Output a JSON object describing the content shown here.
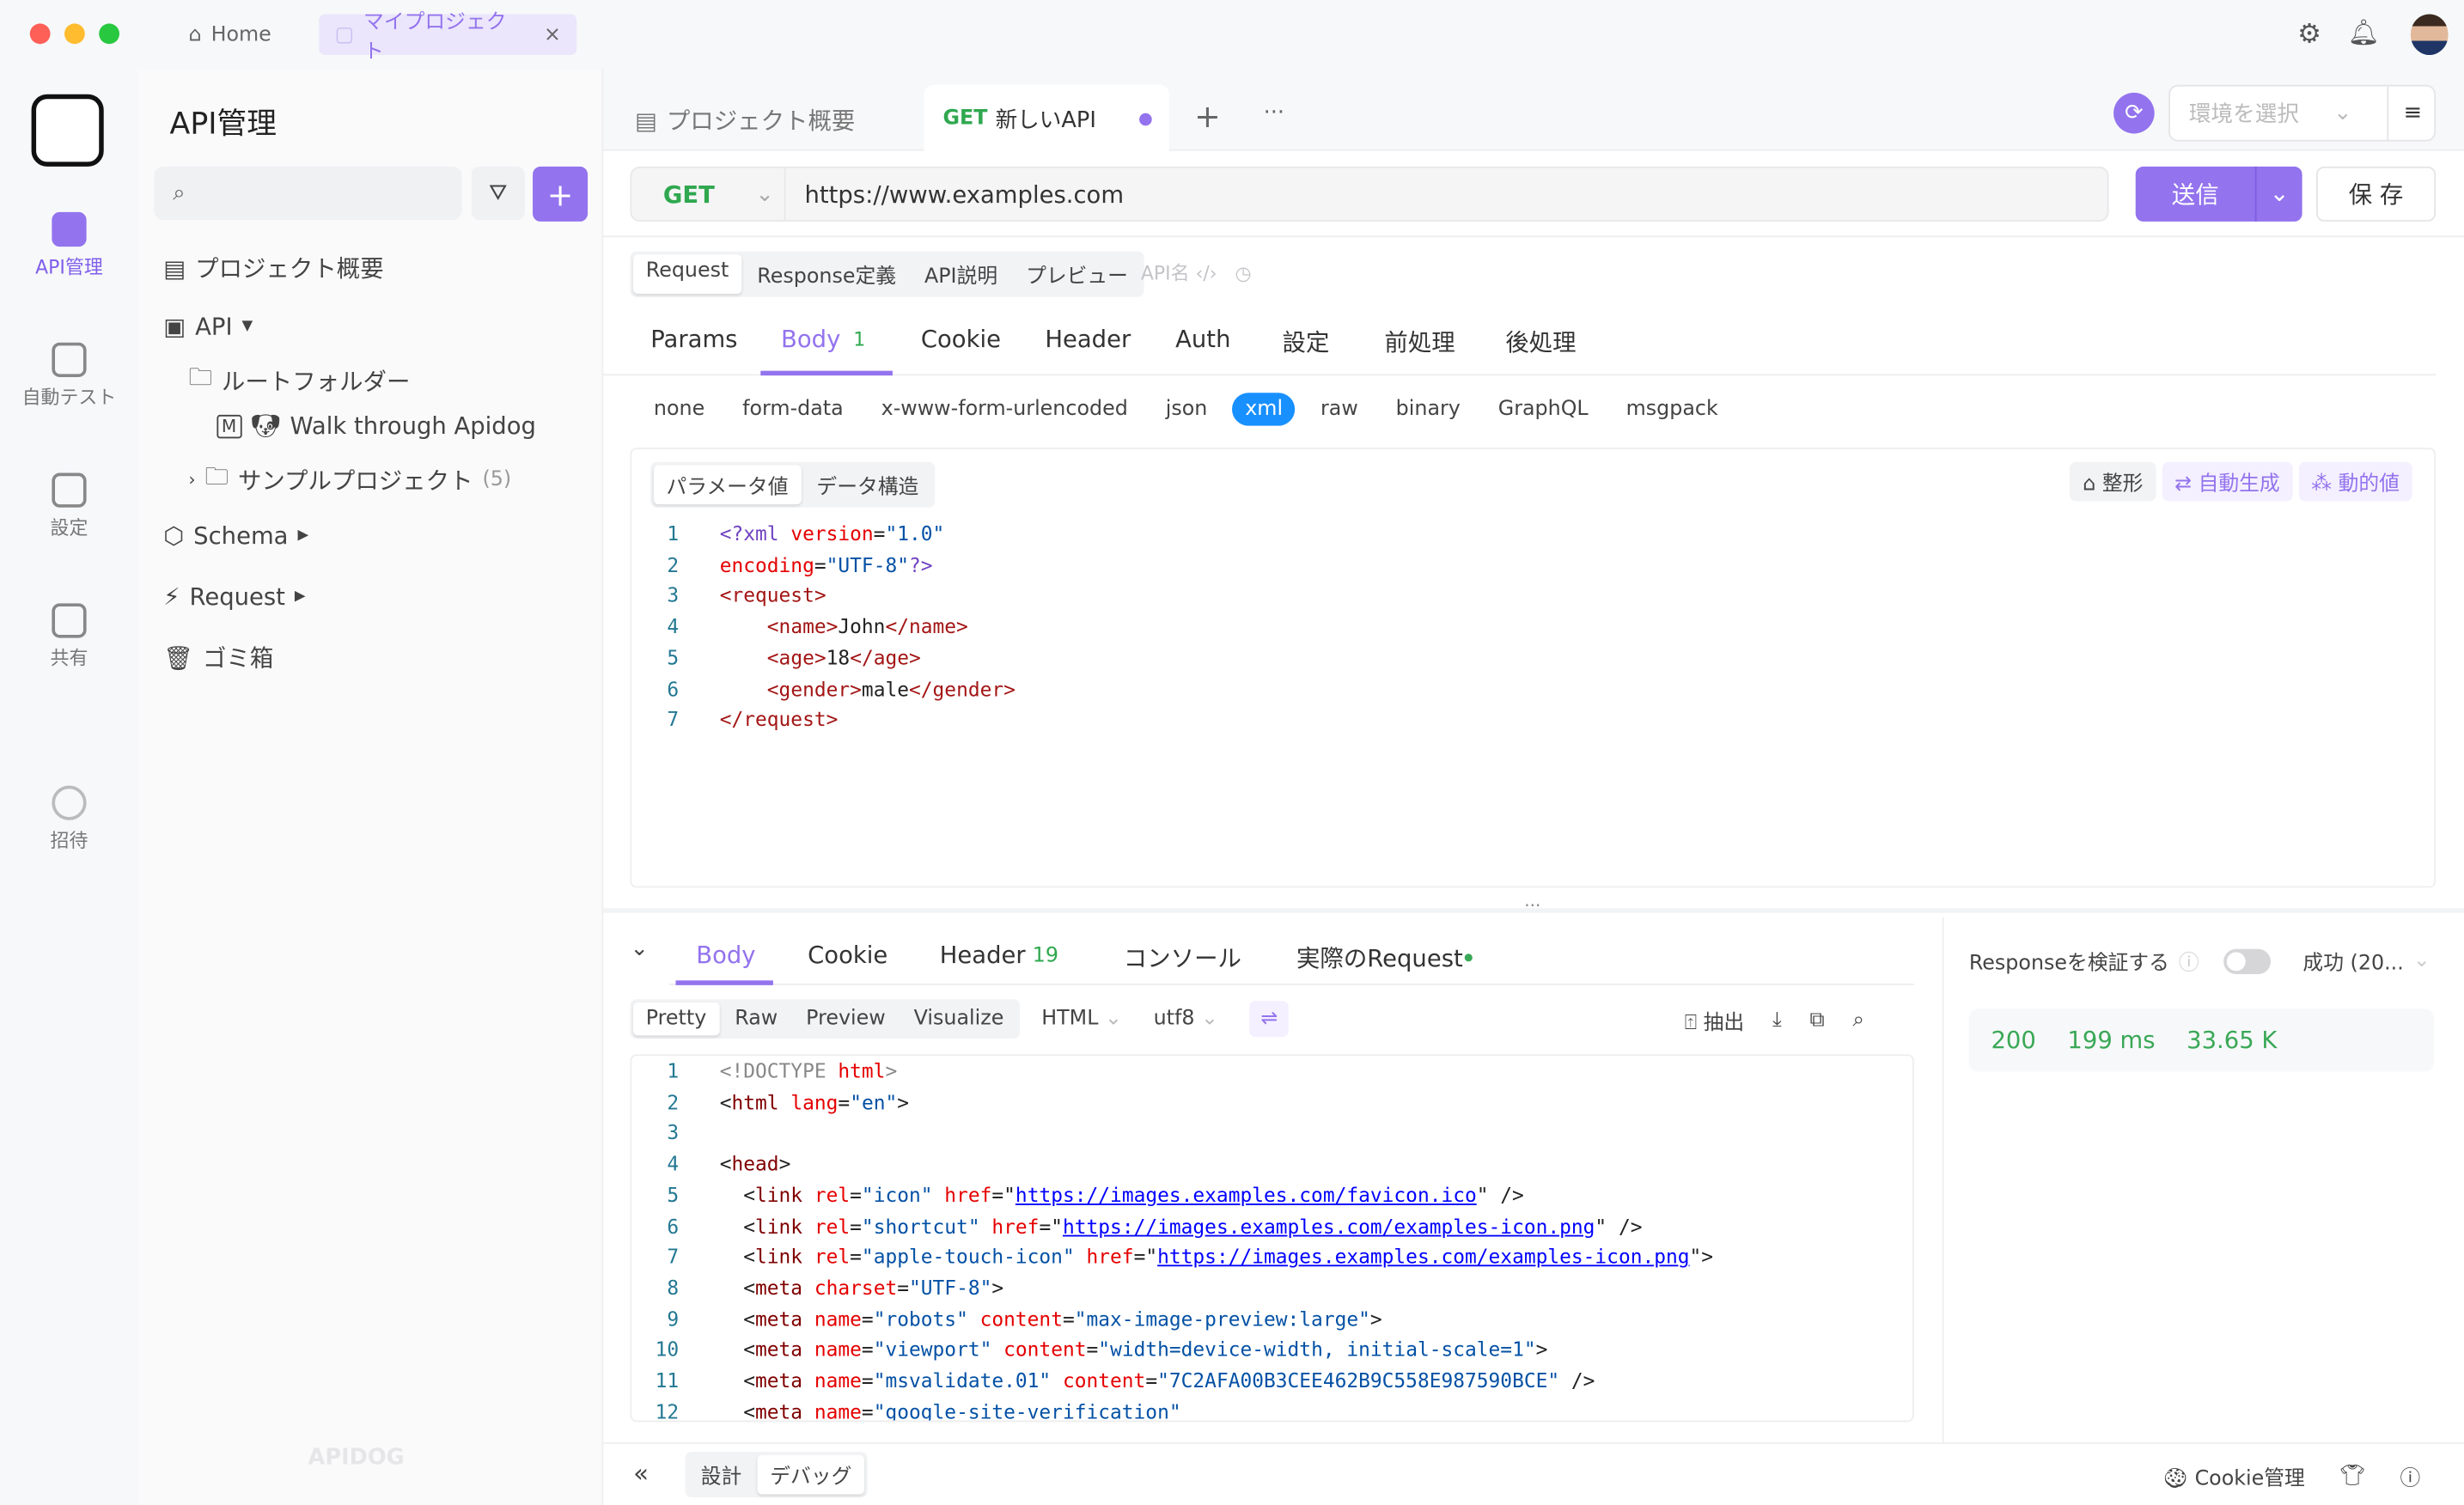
{
  "titlebar": {
    "home": "Home",
    "project_tab": "マイプロジェクト",
    "close": "×"
  },
  "rail": {
    "items": [
      {
        "label": "API管理",
        "active": true
      },
      {
        "label": "自動テスト"
      },
      {
        "label": "設定"
      },
      {
        "label": "共有"
      },
      {
        "label": "招待"
      }
    ]
  },
  "sidebar": {
    "title": "API管理",
    "search_placeholder": "",
    "items": {
      "overview": "プロジェクト概要",
      "api": "API",
      "root": "ルートフォルダー",
      "walk": "Walk through Apidog",
      "sample": "サンプルプロジェクト",
      "sample_count": "(5)",
      "schema": "Schema",
      "request": "Request",
      "trash": "ゴミ箱"
    },
    "watermark": "APIDOG"
  },
  "tabs": {
    "overview": "プロジェクト概要",
    "active_method": "GET",
    "active_name": "新しいAPI",
    "env_placeholder": "環境を選択"
  },
  "request": {
    "method": "GET",
    "url": "https://www.examples.com",
    "send": "送信",
    "save": "保 存"
  },
  "subtabs": {
    "items": [
      "Request",
      "Response定義",
      "API説明",
      "プレビュー"
    ],
    "api_name": "API名"
  },
  "params_tabs": [
    {
      "label": "Params"
    },
    {
      "label": "Body",
      "badge": "1",
      "active": true
    },
    {
      "label": "Cookie"
    },
    {
      "label": "Header"
    },
    {
      "label": "Auth"
    },
    {
      "label": "設定"
    },
    {
      "label": "前処理"
    },
    {
      "label": "後処理"
    }
  ],
  "body_types": [
    "none",
    "form-data",
    "x-www-form-urlencoded",
    "json",
    "xml",
    "raw",
    "binary",
    "GraphQL",
    "msgpack"
  ],
  "body_active": "xml",
  "editor": {
    "mode_tabs": [
      "パラメータ値",
      "データ構造"
    ],
    "format": "整形",
    "autogen": "自動生成",
    "dynamic": "動的値",
    "lines": [
      [
        [
          "t-p",
          "<?xml "
        ],
        [
          "t-at",
          "version"
        ],
        [
          "t-x",
          "="
        ],
        [
          "t-v",
          "\"1.0\""
        ]
      ],
      [
        [
          "t-at",
          "encoding"
        ],
        [
          "t-x",
          "="
        ],
        [
          "t-v",
          "\"UTF-8\""
        ],
        [
          "t-p",
          "?>"
        ]
      ],
      [
        [
          "t-tag",
          "<request>"
        ]
      ],
      [
        [
          "t-x",
          "    "
        ],
        [
          "t-tag",
          "<name>"
        ],
        [
          "t-x",
          "John"
        ],
        [
          "t-tag",
          "</name>"
        ]
      ],
      [
        [
          "t-x",
          "    "
        ],
        [
          "t-tag",
          "<age>"
        ],
        [
          "t-x",
          "18"
        ],
        [
          "t-tag",
          "</age>"
        ]
      ],
      [
        [
          "t-x",
          "    "
        ],
        [
          "t-tag",
          "<gender>"
        ],
        [
          "t-x",
          "male"
        ],
        [
          "t-tag",
          "</gender>"
        ]
      ],
      [
        [
          "t-tag",
          "</request>"
        ]
      ]
    ]
  },
  "response": {
    "tabs": [
      {
        "label": "Body",
        "active": true
      },
      {
        "label": "Cookie"
      },
      {
        "label": "Header",
        "badge": "19"
      },
      {
        "label": "コンソール"
      },
      {
        "label": "実際のRequest"
      }
    ],
    "view_tabs": [
      "Pretty",
      "Raw",
      "Preview",
      "Visualize"
    ],
    "format": "HTML",
    "encoding": "utf8",
    "extract": "抽出",
    "lines": [
      [
        [
          "t-g",
          "<!DOCTYPE "
        ],
        [
          "t-at",
          "html"
        ],
        [
          "t-g",
          ">"
        ]
      ],
      [
        [
          "t-x",
          "<"
        ],
        [
          "t-tn",
          "html "
        ],
        [
          "t-at",
          "lang"
        ],
        [
          "t-x",
          "="
        ],
        [
          "t-v",
          "\"en\""
        ],
        [
          "t-x",
          ">"
        ]
      ],
      [],
      [
        [
          "t-x",
          "<"
        ],
        [
          "t-tn",
          "head"
        ],
        [
          "t-x",
          ">"
        ]
      ],
      [
        [
          "t-x",
          "  <"
        ],
        [
          "t-tn",
          "link "
        ],
        [
          "t-at",
          "rel"
        ],
        [
          "t-x",
          "="
        ],
        [
          "t-v",
          "\"icon\" "
        ],
        [
          "t-at",
          "href"
        ],
        [
          "t-x",
          "=\""
        ],
        [
          "t-u",
          "https://images.examples.com/favicon.ico"
        ],
        [
          "t-x",
          "\" />"
        ]
      ],
      [
        [
          "t-x",
          "  <"
        ],
        [
          "t-tn",
          "link "
        ],
        [
          "t-at",
          "rel"
        ],
        [
          "t-x",
          "="
        ],
        [
          "t-v",
          "\"shortcut\" "
        ],
        [
          "t-at",
          "href"
        ],
        [
          "t-x",
          "=\""
        ],
        [
          "t-u",
          "https://images.examples.com/examples-icon.png"
        ],
        [
          "t-x",
          "\" />"
        ]
      ],
      [
        [
          "t-x",
          "  <"
        ],
        [
          "t-tn",
          "link "
        ],
        [
          "t-at",
          "rel"
        ],
        [
          "t-x",
          "="
        ],
        [
          "t-v",
          "\"apple-touch-icon\" "
        ],
        [
          "t-at",
          "href"
        ],
        [
          "t-x",
          "=\""
        ],
        [
          "t-u",
          "https://images.examples.com/examples-icon.png"
        ],
        [
          "t-x",
          "\">"
        ]
      ],
      [
        [
          "t-x",
          "  <"
        ],
        [
          "t-tn",
          "meta "
        ],
        [
          "t-at",
          "charset"
        ],
        [
          "t-x",
          "="
        ],
        [
          "t-v",
          "\"UTF-8\""
        ],
        [
          "t-x",
          ">"
        ]
      ],
      [
        [
          "t-x",
          "  <"
        ],
        [
          "t-tn",
          "meta "
        ],
        [
          "t-at",
          "name"
        ],
        [
          "t-x",
          "="
        ],
        [
          "t-v",
          "\"robots\" "
        ],
        [
          "t-at",
          "content"
        ],
        [
          "t-x",
          "="
        ],
        [
          "t-v",
          "\"max-image-preview:large\""
        ],
        [
          "t-x",
          ">"
        ]
      ],
      [
        [
          "t-x",
          "  <"
        ],
        [
          "t-tn",
          "meta "
        ],
        [
          "t-at",
          "name"
        ],
        [
          "t-x",
          "="
        ],
        [
          "t-v",
          "\"viewport\" "
        ],
        [
          "t-at",
          "content"
        ],
        [
          "t-x",
          "="
        ],
        [
          "t-v",
          "\"width=device-width, initial-scale=1\""
        ],
        [
          "t-x",
          ">"
        ]
      ],
      [
        [
          "t-x",
          "  <"
        ],
        [
          "t-tn",
          "meta "
        ],
        [
          "t-at",
          "name"
        ],
        [
          "t-x",
          "="
        ],
        [
          "t-v",
          "\"msvalidate.01\" "
        ],
        [
          "t-at",
          "content"
        ],
        [
          "t-x",
          "="
        ],
        [
          "t-v",
          "\"7C2AFA00B3CEE462B9C558E987590BCE\""
        ],
        [
          "t-x",
          " />"
        ]
      ],
      [
        [
          "t-x",
          "  <"
        ],
        [
          "t-tn",
          "meta "
        ],
        [
          "t-at",
          "name"
        ],
        [
          "t-x",
          "="
        ],
        [
          "t-v",
          "\"google-site-verification\""
        ]
      ]
    ]
  },
  "validate": {
    "label": "Responseを検証する",
    "toggle_on": false,
    "status_select": "成功 (20...",
    "status": "200",
    "time": "199 ms",
    "size": "33.65 K"
  },
  "footer": {
    "design": "設計",
    "debug": "デバッグ",
    "cookie": "Cookie管理"
  },
  "colors": {
    "accent": "#9373ee",
    "get": "#2fa84f",
    "xml_chip": "#1890ff",
    "success": "#3aa856"
  }
}
